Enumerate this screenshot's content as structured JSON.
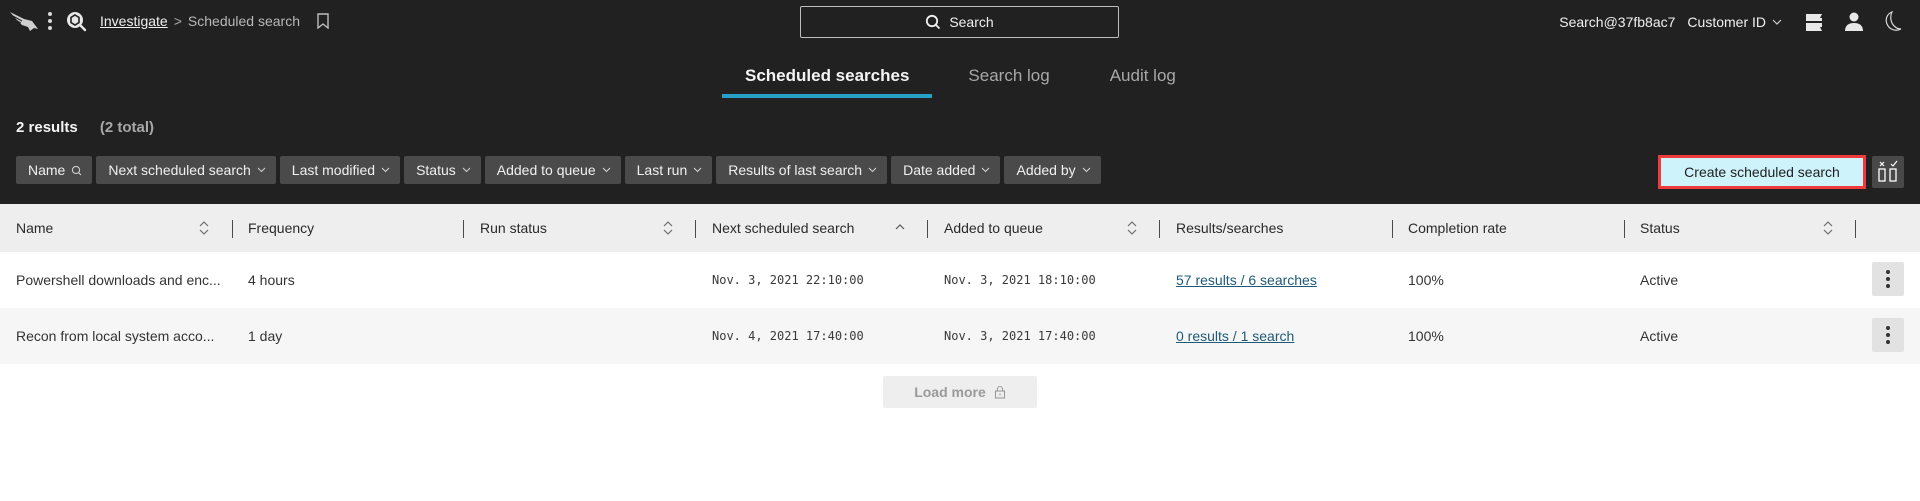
{
  "header": {
    "breadcrumb": {
      "parent": "Investigate",
      "separator": ">",
      "current": "Scheduled search"
    },
    "search_button_label": "Search",
    "user_label": "Search@37fb8ac7",
    "customer_selector_label": "Customer ID",
    "icons": [
      "crowdstrike-falcon-logo",
      "kebab-menu-icon",
      "investigate-app-icon",
      "bookmark-icon",
      "search-icon",
      "support-chat-icon",
      "user-icon",
      "dark-mode-moon-icon"
    ]
  },
  "tabs": [
    {
      "label": "Scheduled searches",
      "active": true
    },
    {
      "label": "Search log",
      "active": false
    },
    {
      "label": "Audit log",
      "active": false
    }
  ],
  "results": {
    "count_label": "2 results",
    "total_label": "(2 total)"
  },
  "filters": [
    {
      "label": "Name",
      "icon": "search-icon"
    },
    {
      "label": "Next scheduled search",
      "icon": "chevron-down-icon"
    },
    {
      "label": "Last modified",
      "icon": "chevron-down-icon"
    },
    {
      "label": "Status",
      "icon": "chevron-down-icon"
    },
    {
      "label": "Added to queue",
      "icon": "chevron-down-icon"
    },
    {
      "label": "Last run",
      "icon": "chevron-down-icon"
    },
    {
      "label": "Results of last search",
      "icon": "chevron-down-icon"
    },
    {
      "label": "Date added",
      "icon": "chevron-down-icon"
    },
    {
      "label": "Added by",
      "icon": "chevron-down-icon"
    }
  ],
  "actions": {
    "create_label": "Create scheduled search",
    "columns_toggle": "column-visibility-icon"
  },
  "table": {
    "columns": [
      {
        "label": "Name",
        "sort": "sortable"
      },
      {
        "label": "Frequency",
        "sort": "none"
      },
      {
        "label": "Run status",
        "sort": "sortable"
      },
      {
        "label": "Next scheduled search",
        "sort": "ascending"
      },
      {
        "label": "Added to queue",
        "sort": "sortable"
      },
      {
        "label": "Results/searches",
        "sort": "none"
      },
      {
        "label": "Completion rate",
        "sort": "none"
      },
      {
        "label": "Status",
        "sort": "sortable"
      }
    ],
    "rows": [
      {
        "name": "Powershell downloads and enc...",
        "frequency": "4 hours",
        "run_status": "",
        "next_scheduled": "Nov. 3, 2021 22:10:00",
        "added_to_queue": "Nov. 3, 2021 18:10:00",
        "results_searches": "57 results / 6 searches",
        "completion_rate": "100%",
        "status": "Active"
      },
      {
        "name": "Recon from local system acco...",
        "frequency": "1 day",
        "run_status": "",
        "next_scheduled": "Nov. 4, 2021 17:40:00",
        "added_to_queue": "Nov. 3, 2021 17:40:00",
        "results_searches": "0 results / 1 search",
        "completion_rate": "100%",
        "status": "Active"
      }
    ]
  },
  "load_more": {
    "label": "Load more",
    "icon": "lock-icon",
    "disabled": true
  },
  "colors": {
    "header_bg": "#212121",
    "active_tab_underline": "#28a0c6",
    "create_button_bg": "#cef3fb",
    "create_button_highlight_border": "#ef3b3b",
    "link": "#1e5a78"
  }
}
